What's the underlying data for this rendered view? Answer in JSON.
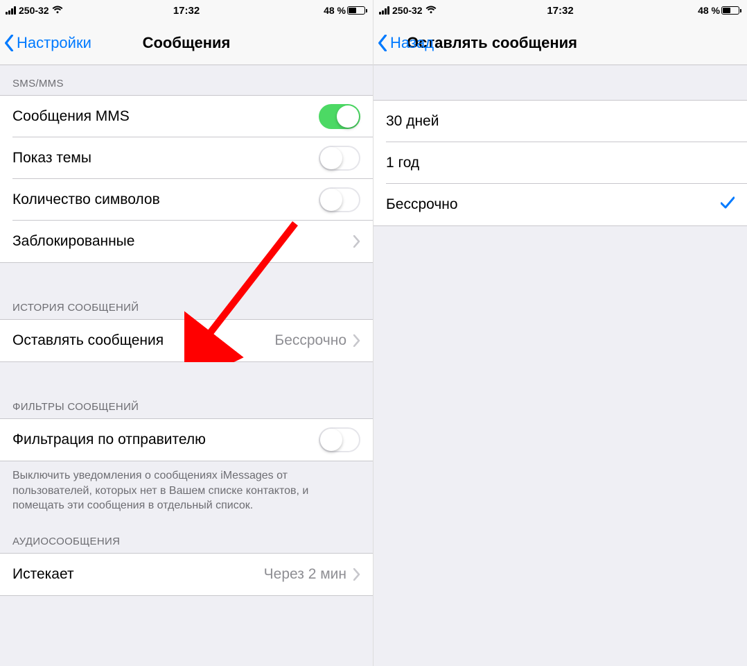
{
  "left": {
    "status": {
      "carrier": "250-32",
      "time": "17:32",
      "battery_pct": "48 %"
    },
    "nav": {
      "back": "Настройки",
      "title": "Сообщения"
    },
    "section_sms_header": "SMS/MMS",
    "rows_sms": [
      {
        "label": "Сообщения MMS",
        "type": "toggle",
        "on": true
      },
      {
        "label": "Показ темы",
        "type": "toggle",
        "on": false
      },
      {
        "label": "Количество символов",
        "type": "toggle",
        "on": false
      },
      {
        "label": "Заблокированные",
        "type": "nav"
      }
    ],
    "section_history_header": "ИСТОРИЯ СООБЩЕНИЙ",
    "row_keep": {
      "label": "Оставлять сообщения",
      "value": "Бессрочно"
    },
    "section_filter_header": "ФИЛЬТРЫ СООБЩЕНИЙ",
    "row_filter": {
      "label": "Фильтрация по отправителю",
      "on": false
    },
    "filter_footer": "Выключить уведомления о сообщениях iMessages от пользователей, которых нет в Вашем списке контактов, и помещать эти сообщения в отдельный список.",
    "section_audio_header": "АУДИОСООБЩЕНИЯ",
    "row_expire": {
      "label": "Истекает",
      "value": "Через 2 мин"
    }
  },
  "right": {
    "status": {
      "carrier": "250-32",
      "time": "17:32",
      "battery_pct": "48 %"
    },
    "nav": {
      "back": "Назад",
      "title": "Оставлять сообщения"
    },
    "options": [
      {
        "label": "30 дней",
        "selected": false
      },
      {
        "label": "1 год",
        "selected": false
      },
      {
        "label": "Бессрочно",
        "selected": true
      }
    ]
  },
  "colors": {
    "accent": "#007aff",
    "toggle_on": "#4cd964",
    "arrow": "#ff0000"
  }
}
